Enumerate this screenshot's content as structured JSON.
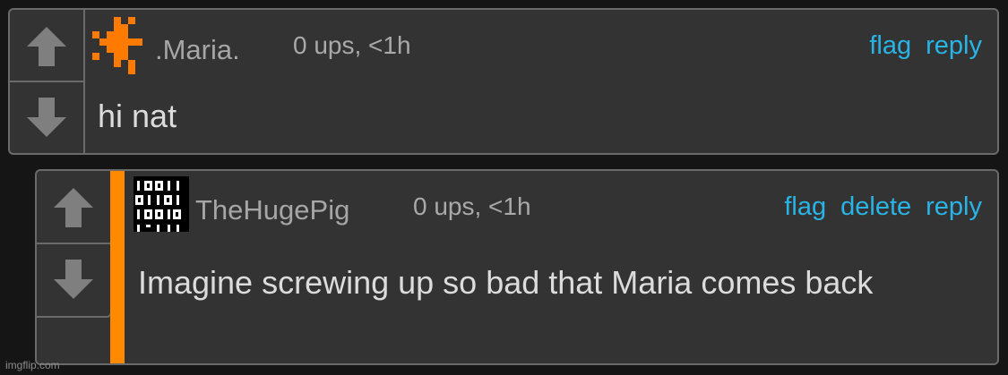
{
  "colors": {
    "background": "#151515",
    "panel": "#333333",
    "border": "#6a6a6a",
    "link": "#29b4e6",
    "reply_stripe": "#ff8a00",
    "vote_arrow": "#7f7f7f"
  },
  "comments": [
    {
      "username": ".Maria.",
      "avatar_icon": "orange-pixel-avatar-icon",
      "meta": "0 ups, <1h",
      "actions": [
        "flag",
        "reply"
      ],
      "text": "hi nat"
    },
    {
      "username": "TheHugePig",
      "avatar_icon": "binary-code-avatar-icon",
      "meta": "0 ups, <1h",
      "actions": [
        "flag",
        "delete",
        "reply"
      ],
      "text": "Imagine screwing up so bad that Maria comes back"
    }
  ],
  "watermark": "imgflip.com"
}
